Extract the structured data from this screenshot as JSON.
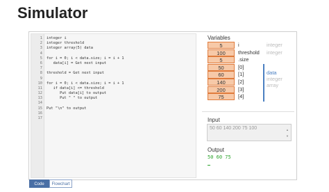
{
  "page": {
    "title": "Simulator"
  },
  "code": {
    "lines": [
      {
        "n": "1",
        "text": "integer i"
      },
      {
        "n": "2",
        "text": "integer threshold"
      },
      {
        "n": "3",
        "text": "integer array(5) data"
      },
      {
        "n": "4",
        "text": ""
      },
      {
        "n": "5",
        "text": "for i = 0; i < data.size; i = i + 1"
      },
      {
        "n": "6",
        "text": "   data[i] = Get next input"
      },
      {
        "n": "7",
        "text": ""
      },
      {
        "n": "8",
        "text": "threshold = Get next input"
      },
      {
        "n": "9",
        "text": ""
      },
      {
        "n": "10",
        "text": "for i = 0; i < data.size; i = i + 1"
      },
      {
        "n": "11",
        "text": "   if data[i] <= threshold"
      },
      {
        "n": "12",
        "text": "      Put data[i] to output"
      },
      {
        "n": "13",
        "text": "      Put \" \" to output"
      },
      {
        "n": "14",
        "text": ""
      },
      {
        "n": "15",
        "text": "Put \"\\n\" to output"
      },
      {
        "n": "16",
        "text": ""
      },
      {
        "n": "17",
        "text": ""
      }
    ]
  },
  "variables": {
    "title": "Variables",
    "rows": [
      {
        "value": "5",
        "name": "i",
        "type": "integer"
      },
      {
        "value": "100",
        "name": "threshold",
        "type": "integer"
      },
      {
        "value": "5",
        "name": ".size",
        "type": ""
      },
      {
        "value": "50",
        "name": "[0]",
        "type": ""
      },
      {
        "value": "60",
        "name": "[1]",
        "type": ""
      },
      {
        "value": "140",
        "name": "[2]",
        "type": ""
      },
      {
        "value": "200",
        "name": "[3]",
        "type": ""
      },
      {
        "value": "75",
        "name": "[4]",
        "type": ""
      }
    ],
    "array_name": "data",
    "array_type_1": "integer",
    "array_type_2": "array"
  },
  "io": {
    "input_label": "Input",
    "input_value": "50 60 140 200 75 100",
    "output_label": "Output",
    "output_value": "50 60 75"
  },
  "tabs": {
    "code": "Code",
    "flowchart": "Flowchart"
  },
  "colors": {
    "cell_fill": "#f7c9a8",
    "cell_border": "#e07b3c",
    "array_accent": "#4a7fc1",
    "output_text": "#2aa22a",
    "tab_active": "#4a6fa5"
  }
}
